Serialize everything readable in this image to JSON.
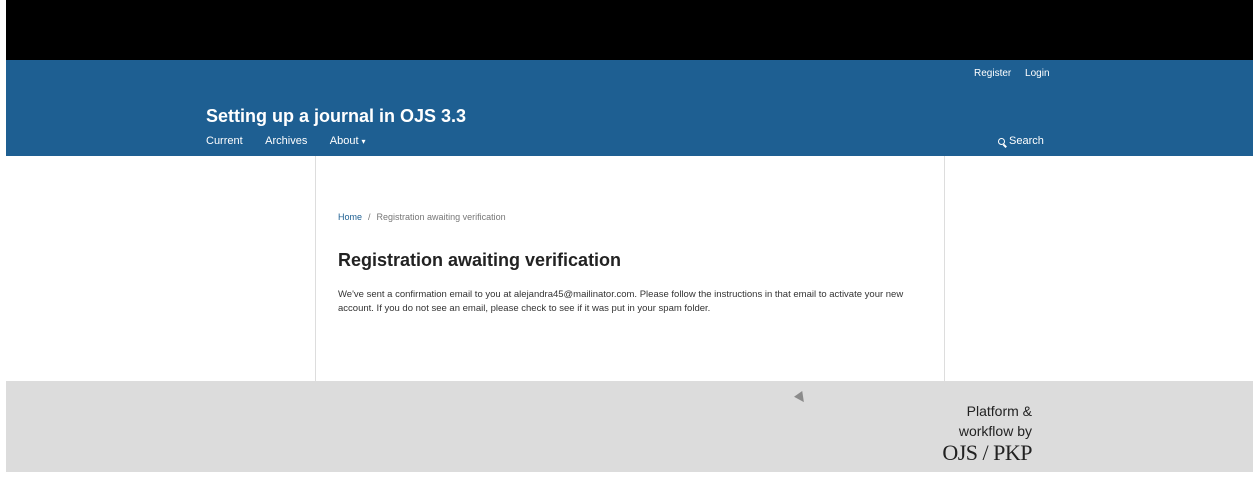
{
  "user_nav": {
    "register": "Register",
    "login": "Login"
  },
  "site": {
    "title": "Setting up a journal in OJS 3.3"
  },
  "primary_nav": {
    "current": "Current",
    "archives": "Archives",
    "about": "About"
  },
  "search": {
    "label": "Search"
  },
  "breadcrumb": {
    "home": "Home",
    "separator": "/",
    "current": "Registration awaiting verification"
  },
  "page": {
    "title": "Registration awaiting verification",
    "message": "We've sent a confirmation email to you at alejandra45@mailinator.com. Please follow the instructions in that email to activate your new account. If you do not see an email, please check to see if it was put in your spam folder."
  },
  "footer": {
    "line1": "Platform &",
    "line2": "workflow by",
    "logo_text": "OJS / PKP"
  },
  "colors": {
    "header": "#1e5f92",
    "footer": "#dcdcdc",
    "link": "#1e5f92"
  },
  "icons": {
    "search": "search-icon",
    "about_menu": "chevron-down-icon",
    "pointer": "mouse-cursor-icon"
  }
}
